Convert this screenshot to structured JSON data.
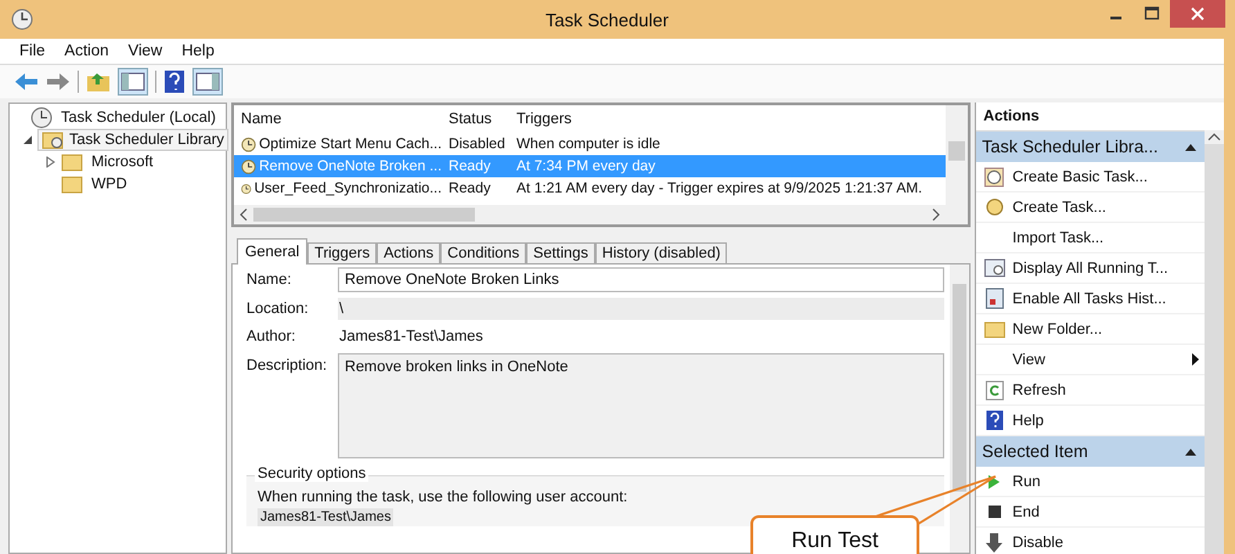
{
  "window": {
    "title": "Task Scheduler"
  },
  "menu": [
    {
      "label": "File"
    },
    {
      "label": "Action"
    },
    {
      "label": "View"
    },
    {
      "label": "Help"
    }
  ],
  "tree": [
    {
      "label": "Task Scheduler (Local)",
      "expandable": false,
      "selected": false,
      "children": [
        {
          "label": "Task Scheduler Library",
          "expandable": true,
          "expanded": true,
          "selected": true,
          "children": [
            {
              "label": "Microsoft",
              "expandable": true,
              "expanded": false,
              "selected": false
            },
            {
              "label": "WPD",
              "expandable": false,
              "selected": false
            }
          ]
        }
      ]
    }
  ],
  "task_table": {
    "columns": [
      "Name",
      "Status",
      "Triggers"
    ],
    "rows": [
      {
        "name": "Optimize Start Menu Cach...",
        "status": "Disabled",
        "triggers": "When computer is idle",
        "selected": false
      },
      {
        "name": "Remove OneNote Broken ...",
        "status": "Ready",
        "triggers": "At 7:34 PM every day",
        "selected": true
      },
      {
        "name": "User_Feed_Synchronizatio...",
        "status": "Ready",
        "triggers": "At 1:21 AM every day - Trigger expires at 9/9/2025 1:21:37 AM.",
        "selected": false
      }
    ]
  },
  "tabs": [
    {
      "label": "General",
      "selected": true
    },
    {
      "label": "Triggers",
      "selected": false
    },
    {
      "label": "Actions",
      "selected": false
    },
    {
      "label": "Conditions",
      "selected": false
    },
    {
      "label": "Settings",
      "selected": false
    },
    {
      "label": "History (disabled)",
      "selected": false
    }
  ],
  "general": {
    "fields": [
      {
        "label": "Name:",
        "value": "Remove OneNote Broken Links",
        "kind": "box"
      },
      {
        "label": "Location:",
        "value": "\\",
        "kind": "shaded"
      },
      {
        "label": "Author:",
        "value": "James81-Test\\James",
        "kind": "plain"
      },
      {
        "label": "Description:",
        "value": "Remove broken links in OneNote",
        "kind": "area"
      }
    ],
    "security_options": {
      "title": "Security options",
      "text": "When running the task, use the following user account:",
      "account": "James81-Test\\James"
    }
  },
  "actions_pane": {
    "title": "Actions",
    "sections": [
      {
        "title": "Task Scheduler Libra...",
        "items": [
          {
            "label": "Create Basic Task...",
            "submenu": false
          },
          {
            "label": "Create Task...",
            "submenu": false
          },
          {
            "label": "Import Task...",
            "submenu": false
          },
          {
            "label": "Display All Running T...",
            "submenu": false
          },
          {
            "label": "Enable All Tasks Hist...",
            "submenu": false
          },
          {
            "label": "New Folder...",
            "submenu": false
          },
          {
            "label": "View",
            "submenu": true
          },
          {
            "label": "Refresh",
            "submenu": false
          },
          {
            "label": "Help",
            "submenu": false
          }
        ]
      },
      {
        "title": "Selected Item",
        "items": [
          {
            "label": "Run",
            "submenu": false
          },
          {
            "label": "End",
            "submenu": false
          },
          {
            "label": "Disable",
            "submenu": false
          }
        ]
      }
    ]
  },
  "callout": {
    "text": "Run Test"
  }
}
